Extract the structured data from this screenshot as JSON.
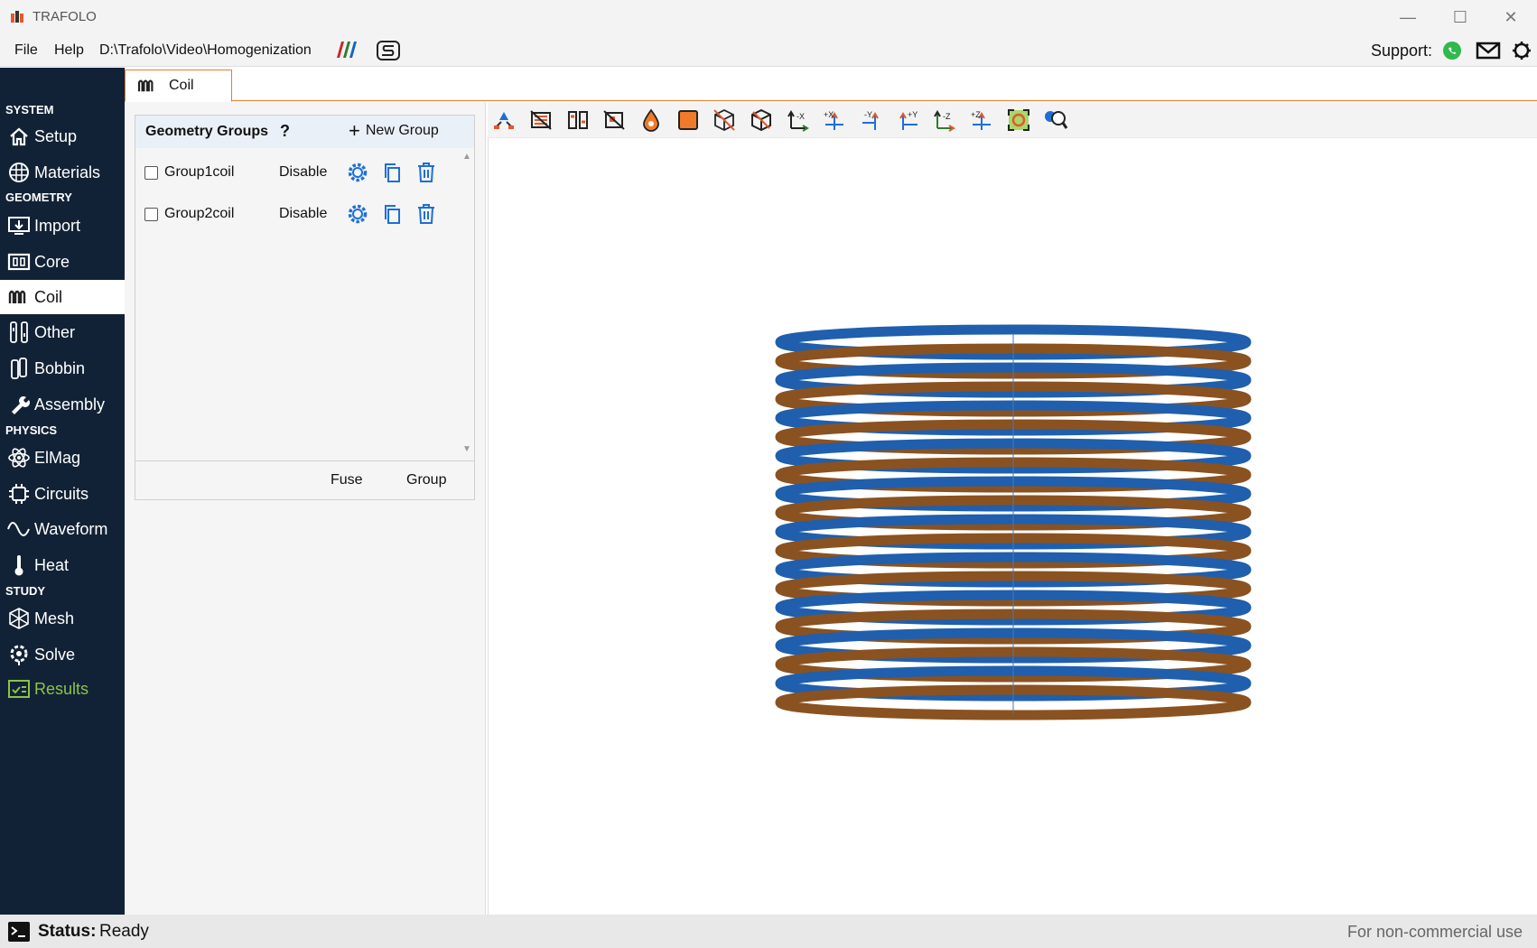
{
  "app": {
    "title": "TRAFOLO"
  },
  "menu": {
    "file": "File",
    "help": "Help",
    "path": "D:\\Trafolo\\Video\\Homogenization",
    "support": "Support:"
  },
  "sidebar": {
    "sections": {
      "system": "SYSTEM",
      "geometry": "GEOMETRY",
      "physics": "PHYSICS",
      "study": "STUDY"
    },
    "items": {
      "setup": "Setup",
      "materials": "Materials",
      "import": "Import",
      "core": "Core",
      "coil": "Coil",
      "other": "Other",
      "bobbin": "Bobbin",
      "assembly": "Assembly",
      "elmag": "ElMag",
      "circuits": "Circuits",
      "waveform": "Waveform",
      "heat": "Heat",
      "mesh": "Mesh",
      "solve": "Solve",
      "results": "Results"
    }
  },
  "tab": {
    "label": "Coil"
  },
  "groups": {
    "title": "Geometry Groups",
    "help": "?",
    "new_group": "New Group",
    "rows": [
      {
        "name": "Group1coil",
        "action": "Disable",
        "checked": false
      },
      {
        "name": "Group2coil",
        "action": "Disable",
        "checked": false
      }
    ],
    "fuse": "Fuse",
    "group": "Group"
  },
  "toolbar": {
    "icons": [
      "explode-icon",
      "hide-icon",
      "split-icon",
      "clip-icon",
      "drop-icon",
      "solid-icon",
      "wireframe-icon",
      "box-icon",
      "view-minus-x-icon",
      "view-plus-x-icon",
      "view-minus-y-icon",
      "view-plus-y-icon",
      "view-minus-z-icon",
      "view-plus-z-icon",
      "fit-icon",
      "pick-icon"
    ],
    "labels": [
      "-X",
      "+X",
      "-Y",
      "+Y",
      "-Z",
      "+Z"
    ]
  },
  "viewport": {
    "coil_colors": {
      "blue": "#1f5fad",
      "copper": "#8a5220"
    }
  },
  "status": {
    "label": "Status:",
    "value": "Ready",
    "note": "For non-commercial use"
  },
  "colors": {
    "sidebar": "#122236",
    "accent": "#f07a2a",
    "icon_blue": "#1d6fd6",
    "results_green": "#8bc34a"
  }
}
